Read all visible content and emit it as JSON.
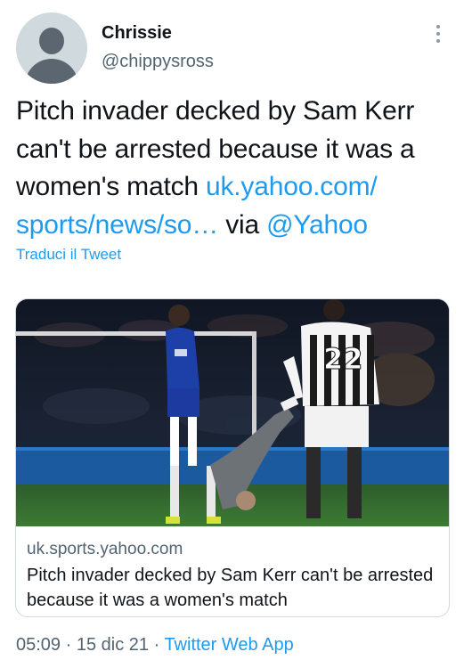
{
  "author": {
    "name": "Chrissie",
    "handle": "@chippysross"
  },
  "tweet": {
    "text_plain": "Pitch invader decked by Sam Kerr can't be arrested because it was a women's match ",
    "link_text": "uk.yahoo.com/ sports/news/so…",
    "via_text": " via ",
    "mention": "@Yahoo",
    "translate_label": "Traduci il Tweet"
  },
  "card": {
    "domain": "uk.sports.yahoo.com",
    "title": "Pitch invader decked by Sam Kerr can't be arrested because it was a women's match",
    "image_icon": "football-match-photo"
  },
  "meta": {
    "time": "05:09",
    "date": "15 dic 21",
    "separator": " · ",
    "app": "Twitter Web App"
  },
  "icons": {
    "more": "more-vertical-icon",
    "avatar": "default-avatar-icon"
  },
  "colors": {
    "link": "#1d9bf0",
    "secondary_text": "#536471",
    "primary_text": "#0f1419"
  }
}
